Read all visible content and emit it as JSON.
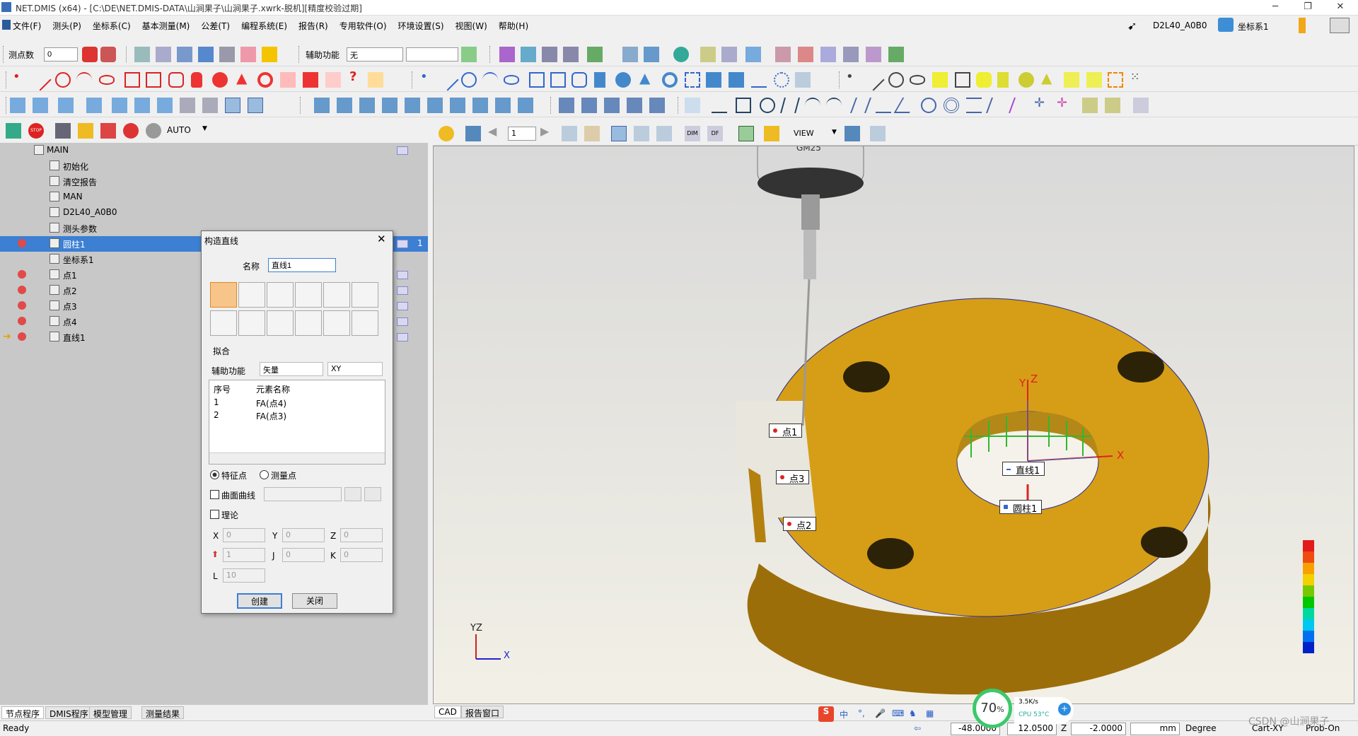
{
  "window": {
    "title": "NET.DMIS (x64) - [C:\\DE\\NET.DMIS-DATA\\山涧果子\\山涧果子.xwrk-脱机][精度校验过期]"
  },
  "menu": [
    "文件(F)",
    "测头(P)",
    "坐标系(C)",
    "基本测量(M)",
    "公差(T)",
    "编程系统(E)",
    "报告(R)",
    "专用软件(O)",
    "环境设置(S)",
    "视图(W)",
    "帮助(H)"
  ],
  "topright": {
    "probe": "D2L40_A0B0",
    "coord": "坐标系1"
  },
  "toolbar": {
    "points_label": "测点数",
    "points_value": "0",
    "assist_label": "辅助功能",
    "assist_value": "无",
    "auto": "AUTO",
    "view_label": "VIEW",
    "page_value": "1"
  },
  "tree": [
    {
      "label": "MAIN",
      "indent": 0,
      "icon": "minus-box-icon"
    },
    {
      "label": "初始化",
      "indent": 1,
      "icon": "init-icon"
    },
    {
      "label": "清空报告",
      "indent": 1,
      "icon": "clear-report-icon"
    },
    {
      "label": "MAN",
      "indent": 1,
      "icon": "mode-icon"
    },
    {
      "label": "D2L40_A0B0",
      "indent": 1,
      "icon": "probe-icon"
    },
    {
      "label": "测头参数",
      "indent": 1,
      "icon": "probe-param-icon"
    },
    {
      "label": "圆柱1",
      "indent": 1,
      "icon": "cylinder-icon",
      "selected": true,
      "badge": "1"
    },
    {
      "label": "坐标系1",
      "indent": 1,
      "icon": "coord-icon"
    },
    {
      "label": "点1",
      "indent": 1,
      "icon": "point-icon"
    },
    {
      "label": "点2",
      "indent": 1,
      "icon": "point-icon"
    },
    {
      "label": "点3",
      "indent": 1,
      "icon": "point-icon"
    },
    {
      "label": "点4",
      "indent": 1,
      "icon": "point-icon"
    },
    {
      "label": "直线1",
      "indent": 1,
      "icon": "line-icon",
      "current": true
    }
  ],
  "tabs": [
    "节点程序",
    "DMIS程序",
    "模型管理",
    "测量结果"
  ],
  "viewtabs": [
    "CAD",
    "报告窗口"
  ],
  "dialog": {
    "title": "构造直线",
    "name_label": "名称",
    "name_value": "直线1",
    "fit_label": "拟合",
    "assist_label": "辅助功能",
    "assist_value": "矢量",
    "plane_value": "XY",
    "col_index": "序号",
    "col_name": "元素名称",
    "rows": [
      {
        "i": "1",
        "name": "FA(点4)"
      },
      {
        "i": "2",
        "name": "FA(点3)"
      }
    ],
    "radio1": "特征点",
    "radio2": "测量点",
    "surface_label": "曲面曲线",
    "theory_label": "理论",
    "x": "0",
    "y": "0",
    "z": "0",
    "i": "1",
    "j": "0",
    "k": "0",
    "l": "10",
    "create": "创建",
    "close": "关闭"
  },
  "labels3d": {
    "p1": "点1",
    "p2": "点2",
    "p3": "点3",
    "line": "直线1",
    "cyl": "圆柱1",
    "probe": "GM25"
  },
  "status": {
    "ready": "Ready",
    "x": "-48.0000",
    "y": "12.0500",
    "z_label": "Z",
    "z": "-2.0000",
    "unit": "mm",
    "angle": "Degree",
    "coord": "Cart-XY",
    "probe": "Prob-On"
  },
  "tray": {
    "cpu_pct": "70",
    "net": "3.5K/s",
    "cpu": "CPU 53°C",
    "watermark": "CSDN @山涧果子"
  },
  "colors": {
    "part": "#d69e16",
    "select": "#3c7fd3"
  }
}
